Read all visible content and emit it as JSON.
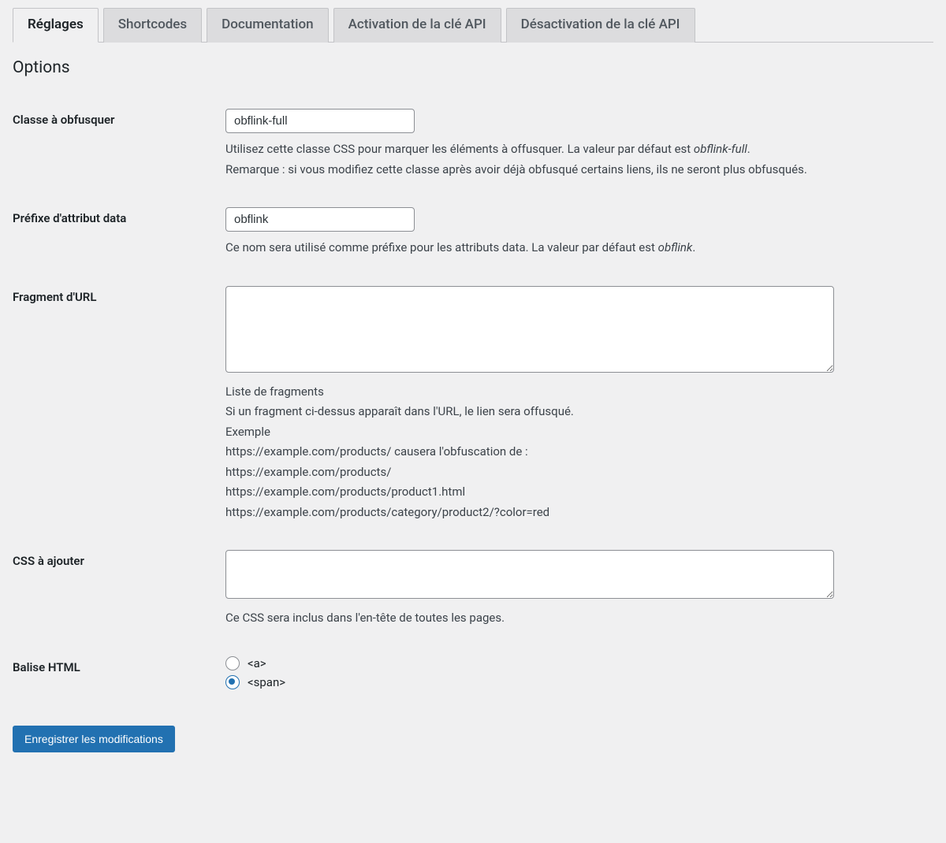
{
  "tabs": [
    {
      "label": "Réglages",
      "active": true
    },
    {
      "label": "Shortcodes",
      "active": false
    },
    {
      "label": "Documentation",
      "active": false
    },
    {
      "label": "Activation de la clé API",
      "active": false
    },
    {
      "label": "Désactivation de la clé API",
      "active": false
    }
  ],
  "section_title": "Options",
  "fields": {
    "class_obfuscate": {
      "label": "Classe à obfusquer",
      "value": "obflink-full",
      "desc_1": "Utilisez cette classe CSS pour marquer les éléments à offusquer. La valeur par défaut est ",
      "desc_1_em": "obflink-full",
      "desc_1_suffix": ".",
      "desc_2": "Remarque : si vous modifiez cette classe après avoir déjà obfusqué certains liens, ils ne seront plus obfusqués."
    },
    "data_prefix": {
      "label": "Préfixe d'attribut data",
      "value": "obflink",
      "desc": "Ce nom sera utilisé comme préfixe pour les attributs data. La valeur par défaut est ",
      "desc_em": "obflink",
      "desc_suffix": "."
    },
    "url_fragment": {
      "label": "Fragment d'URL",
      "value": "",
      "desc_lines": {
        "l1": "Liste de fragments",
        "l2": "Si un fragment ci-dessus apparaît dans l'URL, le lien sera offusqué.",
        "l3": "Exemple",
        "l4": "https://example.com/products/ causera l'obfuscation de :",
        "l5": "https://example.com/products/",
        "l6": "https://example.com/products/product1.html",
        "l7": "https://example.com/products/category/product2/?color=red"
      }
    },
    "css_add": {
      "label": "CSS à ajouter",
      "value": "",
      "desc": "Ce CSS sera inclus dans l'en-tête de toutes les pages."
    },
    "html_tag": {
      "label": "Balise HTML",
      "option_a": "<a>",
      "option_span": "<span>",
      "selected": "span"
    }
  },
  "submit_label": "Enregistrer les modifications"
}
